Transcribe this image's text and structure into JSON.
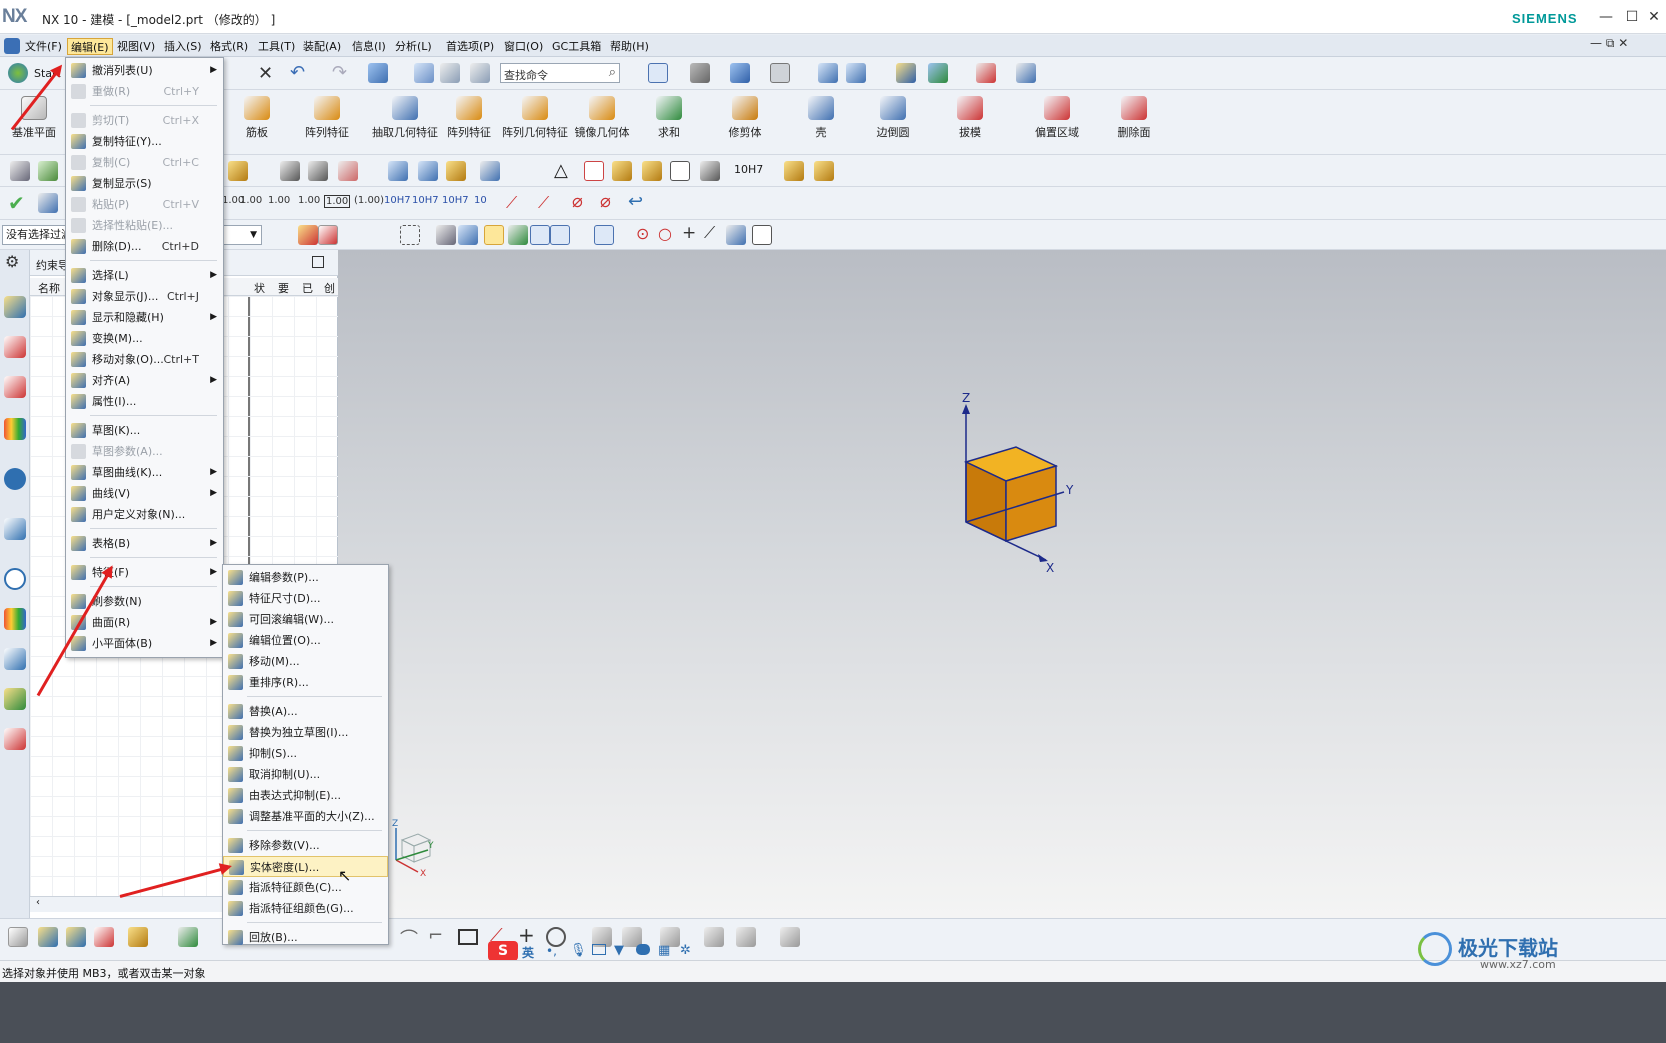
{
  "window": {
    "logo": "NX",
    "title": "NX 10 - 建模 - [_model2.prt （修改的） ]",
    "brand": "SIEMENS",
    "min": "—",
    "max": "☐",
    "close": "✕"
  },
  "menubar": [
    "文件(F)",
    "编辑(E)",
    "视图(V)",
    "插入(S)",
    "格式(R)",
    "工具(T)",
    "装配(A)",
    "信息(I)",
    "分析(L)",
    "首选项(P)",
    "窗口(O)",
    "GC工具箱",
    "帮助(H)"
  ],
  "toolbar": {
    "start": "Start",
    "search_placeholder": "查找命令",
    "datum_plane": "基准平面",
    "big_buttons": [
      "筋板",
      "阵列特征",
      "抽取几何特征",
      "阵列特征",
      "阵列几何特征",
      "镜像几何体",
      "求和",
      "修剪体",
      "壳",
      "边倒圆",
      "拔模",
      "偏置区域",
      "删除面"
    ],
    "tolerances": [
      "1.00",
      "1.00",
      "1.00",
      "1.00",
      "1.00",
      "(1.00)",
      "10H7",
      "10H7",
      "10H7",
      "10"
    ],
    "filter_value": "没有选择过滤器",
    "fit_label": "10H7"
  },
  "navigator": {
    "title": "约束导航器",
    "cols": [
      "名称",
      "状",
      "要",
      "已",
      "创"
    ]
  },
  "edit_menu": [
    {
      "label": "撤消列表(U)",
      "sc": "",
      "sub": true,
      "dis": false
    },
    {
      "label": "重做(R)",
      "sc": "Ctrl+Y",
      "sub": false,
      "dis": true
    },
    {
      "sep": true
    },
    {
      "label": "剪切(T)",
      "sc": "Ctrl+X",
      "sub": false,
      "dis": true
    },
    {
      "label": "复制特征(Y)...",
      "sc": "",
      "sub": false,
      "dis": false
    },
    {
      "label": "复制(C)",
      "sc": "Ctrl+C",
      "sub": false,
      "dis": true
    },
    {
      "label": "复制显示(S)",
      "sc": "",
      "sub": false,
      "dis": false
    },
    {
      "label": "粘贴(P)",
      "sc": "Ctrl+V",
      "sub": false,
      "dis": true
    },
    {
      "label": "选择性粘贴(E)...",
      "sc": "",
      "sub": false,
      "dis": true
    },
    {
      "label": "删除(D)...",
      "sc": "Ctrl+D",
      "sub": false,
      "dis": false
    },
    {
      "sep": true
    },
    {
      "label": "选择(L)",
      "sc": "",
      "sub": true,
      "dis": false
    },
    {
      "label": "对象显示(J)...",
      "sc": "Ctrl+J",
      "sub": false,
      "dis": false
    },
    {
      "label": "显示和隐藏(H)",
      "sc": "",
      "sub": true,
      "dis": false
    },
    {
      "label": "变换(M)...",
      "sc": "",
      "sub": false,
      "dis": false
    },
    {
      "label": "移动对象(O)...",
      "sc": "Ctrl+T",
      "sub": false,
      "dis": false
    },
    {
      "label": "对齐(A)",
      "sc": "",
      "sub": true,
      "dis": false
    },
    {
      "label": "属性(I)...",
      "sc": "",
      "sub": false,
      "dis": false
    },
    {
      "sep": true
    },
    {
      "label": "草图(K)...",
      "sc": "",
      "sub": false,
      "dis": false
    },
    {
      "label": "草图参数(A)...",
      "sc": "",
      "sub": false,
      "dis": true
    },
    {
      "label": "草图曲线(K)...",
      "sc": "",
      "sub": true,
      "dis": false
    },
    {
      "label": "曲线(V)",
      "sc": "",
      "sub": true,
      "dis": false
    },
    {
      "label": "用户定义对象(N)...",
      "sc": "",
      "sub": false,
      "dis": false
    },
    {
      "sep": true
    },
    {
      "label": "表格(B)",
      "sc": "",
      "sub": true,
      "dis": false
    },
    {
      "sep": true
    },
    {
      "label": "特征(F)",
      "sc": "",
      "sub": true,
      "dis": false
    },
    {
      "sep": true
    },
    {
      "label": "刷参数(N)",
      "sc": "",
      "sub": false,
      "dis": false
    },
    {
      "label": "曲面(R)",
      "sc": "",
      "sub": true,
      "dis": false
    },
    {
      "label": "小平面体(B)",
      "sc": "",
      "sub": true,
      "dis": false
    }
  ],
  "feature_menu": [
    {
      "label": "编辑参数(P)..."
    },
    {
      "label": "特征尺寸(D)..."
    },
    {
      "label": "可回滚编辑(W)..."
    },
    {
      "label": "编辑位置(O)..."
    },
    {
      "label": "移动(M)..."
    },
    {
      "label": "重排序(R)..."
    },
    {
      "sep": true
    },
    {
      "label": "替换(A)..."
    },
    {
      "label": "替换为独立草图(I)..."
    },
    {
      "label": "抑制(S)..."
    },
    {
      "label": "取消抑制(U)..."
    },
    {
      "label": "由表达式抑制(E)..."
    },
    {
      "label": "调整基准平面的大小(Z)..."
    },
    {
      "sep": true
    },
    {
      "label": "移除参数(V)..."
    },
    {
      "label": "实体密度(L)...",
      "hl": true
    },
    {
      "label": "指派特征颜色(C)..."
    },
    {
      "label": "指派特征组颜色(G)..."
    },
    {
      "sep": true
    },
    {
      "label": "回放(B)..."
    }
  ],
  "axes": {
    "z": "Z",
    "y": "Y",
    "x": "X"
  },
  "status": "选择对象并使用 MB3，或者双击某一对象",
  "ime": {
    "lang": "英",
    "punct": "•,"
  },
  "watermark": {
    "name": "极光下载站",
    "url": "www.xz7.com"
  },
  "colors": {
    "cube_top": "#f2b323",
    "cube_front": "#d98a10",
    "cube_side": "#c87a0a",
    "accent": "#009999",
    "arrow": "#e02020"
  }
}
